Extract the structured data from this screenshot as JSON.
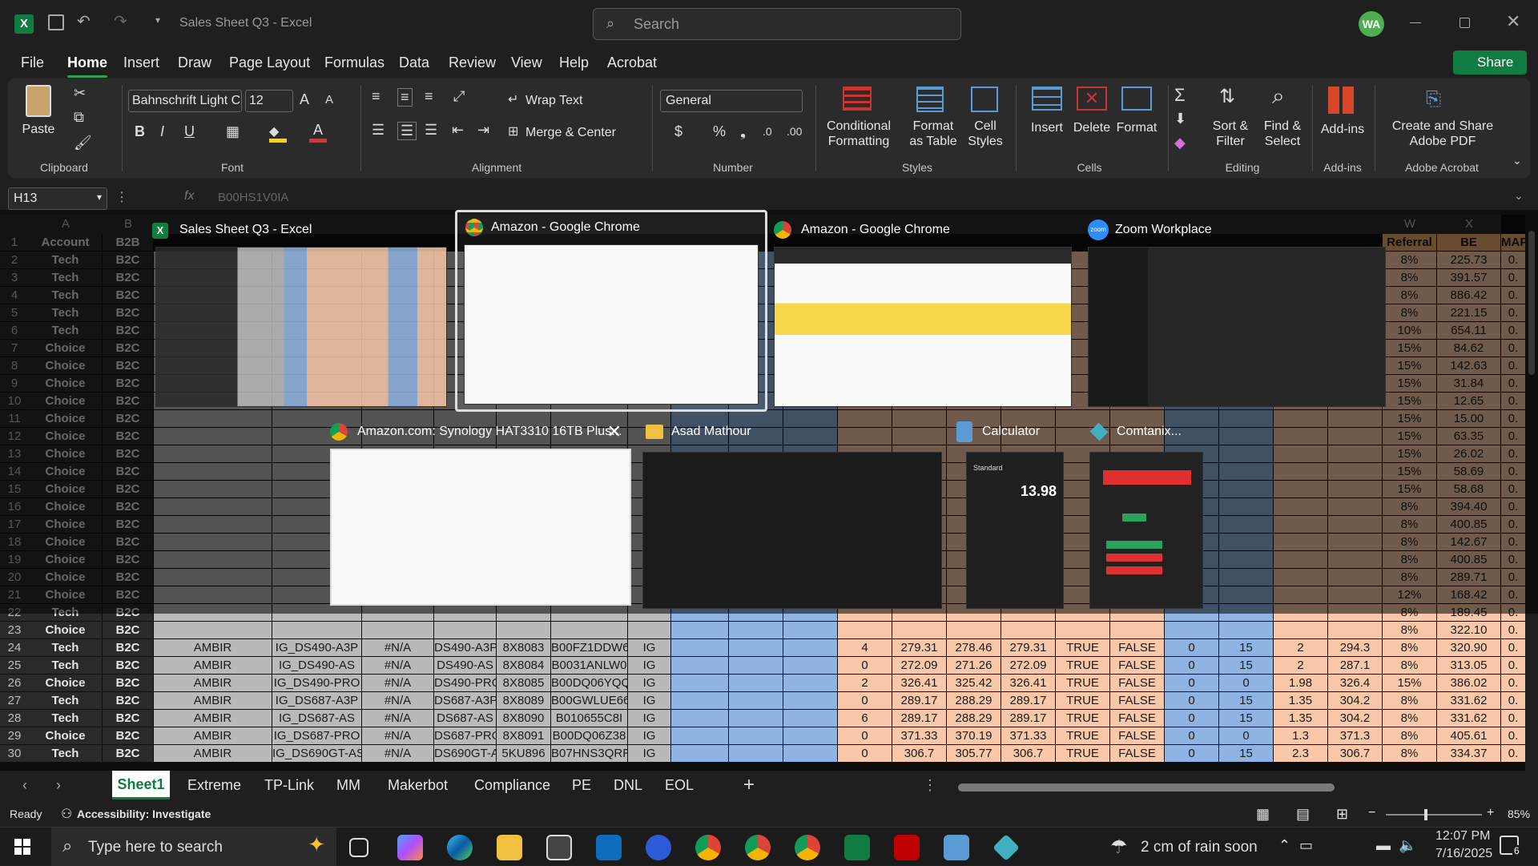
{
  "window": {
    "title": "Sales Sheet Q3 - Excel",
    "search_placeholder": "Search",
    "user_initials": "WA",
    "share_label": "Share"
  },
  "menu": [
    "File",
    "Home",
    "Insert",
    "Draw",
    "Page Layout",
    "Formulas",
    "Data",
    "Review",
    "View",
    "Help",
    "Acrobat"
  ],
  "ribbon": {
    "clipboard": {
      "paste": "Paste",
      "group": "Clipboard"
    },
    "font": {
      "name": "Bahnschrift Light C",
      "size": "12",
      "group": "Font"
    },
    "alignment": {
      "wrap": "Wrap Text",
      "merge": "Merge & Center",
      "group": "Alignment"
    },
    "number": {
      "format": "General",
      "group": "Number"
    },
    "styles": {
      "conditional": "Conditional Formatting",
      "format_table": "Format as Table",
      "cell_styles": "Cell Styles",
      "group": "Styles"
    },
    "cells": {
      "insert": "Insert",
      "delete": "Delete",
      "format": "Format",
      "group": "Cells"
    },
    "editing": {
      "sort": "Sort & Filter",
      "find": "Find & Select",
      "group": "Editing"
    },
    "addins": {
      "label": "Add-ins",
      "group": "Add-ins"
    },
    "acrobat": {
      "label": "Create and Share Adobe PDF",
      "group": "Adobe Acrobat"
    }
  },
  "formula": {
    "name_box": "H13",
    "fx": "fx",
    "content": "B00HS1V0IA"
  },
  "columns": [
    "A",
    "B",
    "",
    "",
    "",
    "",
    "",
    "",
    "",
    "",
    "",
    "",
    "",
    "",
    "",
    "",
    "",
    "",
    "",
    "",
    "",
    "",
    "",
    "",
    "W",
    "X"
  ],
  "rows": [
    {
      "n": "1",
      "a": "Account",
      "b": "B2B"
    },
    {
      "n": "2",
      "a": "Tech",
      "b": "B2C"
    },
    {
      "n": "3",
      "a": "Tech",
      "b": "B2C"
    },
    {
      "n": "4",
      "a": "Tech",
      "b": "B2C"
    },
    {
      "n": "5",
      "a": "Tech",
      "b": "B2C"
    },
    {
      "n": "6",
      "a": "Tech",
      "b": "B2C"
    },
    {
      "n": "7",
      "a": "Choice",
      "b": "B2C"
    },
    {
      "n": "8",
      "a": "Choice",
      "b": "B2C"
    },
    {
      "n": "9",
      "a": "Choice",
      "b": "B2C"
    },
    {
      "n": "10",
      "a": "Choice",
      "b": "B2C"
    },
    {
      "n": "11",
      "a": "Choice",
      "b": "B2C"
    },
    {
      "n": "12",
      "a": "Choice",
      "b": "B2C"
    },
    {
      "n": "13",
      "a": "Choice",
      "b": "B2C"
    },
    {
      "n": "14",
      "a": "Choice",
      "b": "B2C"
    },
    {
      "n": "15",
      "a": "Choice",
      "b": "B2C"
    },
    {
      "n": "16",
      "a": "Choice",
      "b": "B2C"
    },
    {
      "n": "17",
      "a": "Choice",
      "b": "B2C"
    },
    {
      "n": "18",
      "a": "Choice",
      "b": "B2C"
    },
    {
      "n": "19",
      "a": "Choice",
      "b": "B2C"
    },
    {
      "n": "20",
      "a": "Choice",
      "b": "B2C"
    },
    {
      "n": "21",
      "a": "Choice",
      "b": "B2C"
    },
    {
      "n": "22",
      "a": "Tech",
      "b": "B2C"
    },
    {
      "n": "23",
      "a": "Choice",
      "b": "B2C"
    },
    {
      "n": "24",
      "a": "Tech",
      "b": "B2C"
    },
    {
      "n": "25",
      "a": "Tech",
      "b": "B2C"
    },
    {
      "n": "26",
      "a": "Choice",
      "b": "B2C"
    },
    {
      "n": "27",
      "a": "Tech",
      "b": "B2C"
    },
    {
      "n": "28",
      "a": "Tech",
      "b": "B2C"
    },
    {
      "n": "29",
      "a": "Choice",
      "b": "B2C"
    },
    {
      "n": "30",
      "a": "Tech",
      "b": "B2C"
    }
  ],
  "right_col": {
    "header_w": "Referral",
    "header_x": "BE",
    "header_y": "MAP",
    "be": [
      "225.73",
      "391.57",
      "886.42",
      "221.15",
      "654.11",
      "84.62",
      "142.63",
      "31.84",
      "12.65",
      "15.00",
      "63.35",
      "26.02",
      "58.69",
      "58.68",
      "394.40",
      "400.85",
      "142.67",
      "400.85",
      "289.71",
      "168.42",
      "189.45",
      "322.10",
      "320.90",
      "313.05",
      "386.02",
      "331.62",
      "331.62",
      "405.61",
      "334.37"
    ],
    "ref": [
      "8%",
      "8%",
      "8%",
      "8%",
      "10%",
      "15%",
      "15%",
      "15%",
      "15%",
      "15%",
      "15%",
      "15%",
      "15%",
      "15%",
      "8%",
      "8%",
      "8%",
      "8%",
      "8%",
      "12%",
      "8%",
      "8%",
      "8%",
      "8%",
      "15%",
      "8%",
      "8%",
      "8%",
      "8%"
    ]
  },
  "visible_rows": [
    {
      "c": "AMBIR",
      "d": "IG_DS490-A3P",
      "e": "#N/A",
      "f": "DS490-A3P",
      "g": "8X8083",
      "h": "B00FZ1DDW6",
      "i": "IG",
      "n": "4",
      "o": "279.31",
      "p": "278.46",
      "q": "279.31",
      "r": "TRUE",
      "s": "FALSE",
      "t": "0",
      "u": "15",
      "v": "2",
      "w": "294.3"
    },
    {
      "c": "AMBIR",
      "d": "IG_DS490-AS",
      "e": "#N/A",
      "f": "DS490-AS",
      "g": "8X8084",
      "h": "B0031ANLW0",
      "i": "IG",
      "n": "0",
      "o": "272.09",
      "p": "271.26",
      "q": "272.09",
      "r": "TRUE",
      "s": "FALSE",
      "t": "0",
      "u": "15",
      "v": "2",
      "w": "287.1"
    },
    {
      "c": "AMBIR",
      "d": "IG_DS490-PRO",
      "e": "#N/A",
      "f": "DS490-PRO",
      "g": "8X8085",
      "h": "B00DQ06YQQ",
      "i": "IG",
      "n": "2",
      "o": "326.41",
      "p": "325.42",
      "q": "326.41",
      "r": "TRUE",
      "s": "FALSE",
      "t": "0",
      "u": "0",
      "v": "1.98",
      "w": "326.4"
    },
    {
      "c": "AMBIR",
      "d": "IG_DS687-A3P",
      "e": "#N/A",
      "f": "DS687-A3P",
      "g": "8X8089",
      "h": "B00GWLUE66",
      "i": "IG",
      "n": "0",
      "o": "289.17",
      "p": "288.29",
      "q": "289.17",
      "r": "TRUE",
      "s": "FALSE",
      "t": "0",
      "u": "15",
      "v": "1.35",
      "w": "304.2"
    },
    {
      "c": "AMBIR",
      "d": "IG_DS687-AS",
      "e": "#N/A",
      "f": "DS687-AS",
      "g": "8X8090",
      "h": "B010655C8I",
      "i": "IG",
      "n": "6",
      "o": "289.17",
      "p": "288.29",
      "q": "289.17",
      "r": "TRUE",
      "s": "FALSE",
      "t": "0",
      "u": "15",
      "v": "1.35",
      "w": "304.2"
    },
    {
      "c": "AMBIR",
      "d": "IG_DS687-PRO",
      "e": "#N/A",
      "f": "DS687-PRO",
      "g": "8X8091",
      "h": "B00DQ06Z38",
      "i": "IG",
      "n": "0",
      "o": "371.33",
      "p": "370.19",
      "q": "371.33",
      "r": "TRUE",
      "s": "FALSE",
      "t": "0",
      "u": "0",
      "v": "1.3",
      "w": "371.3"
    },
    {
      "c": "AMBIR",
      "d": "IG_DS690GT-AS",
      "e": "#N/A",
      "f": "DS690GT-AS",
      "g": "5KU896",
      "h": "B07HNS3QRR",
      "i": "IG",
      "n": "0",
      "o": "306.7",
      "p": "305.77",
      "q": "306.7",
      "r": "TRUE",
      "s": "FALSE",
      "t": "0",
      "u": "15",
      "v": "2.3",
      "w": "306.7"
    }
  ],
  "task_switcher": [
    {
      "title": "Sales Sheet Q3 - Excel",
      "app": "excel"
    },
    {
      "title": "Amazon - Google Chrome",
      "app": "chrome"
    },
    {
      "title": "Amazon - Google Chrome",
      "app": "chrome"
    },
    {
      "title": "Zoom Workplace",
      "app": "zoom"
    },
    {
      "title": "Amazon.com: Synology HAT3310 16TB Plus...",
      "app": "chrome"
    },
    {
      "title": "Asad Mathour",
      "app": "folder"
    },
    {
      "title": "Calculator",
      "app": "calc"
    },
    {
      "title": "Comtanix...",
      "app": "comtanix"
    }
  ],
  "calculator": {
    "mode": "Standard",
    "value": "13.98"
  },
  "sheet_tabs": [
    "Sheet1",
    "Extreme",
    "TP-Link",
    "MM",
    "Makerbot",
    "Compliance",
    "PE",
    "DNL",
    "EOL"
  ],
  "status": {
    "ready": "Ready",
    "accessibility": "Accessibility: Investigate",
    "zoom": "85%"
  },
  "taskbar": {
    "search": "Type here to search",
    "weather": "2 cm of rain soon",
    "time": "12:07 PM",
    "date": "7/16/2025",
    "notif": "6"
  },
  "colors": {
    "accent": "#107c41",
    "orange": "#f8c8a8",
    "blue": "#8fb4e3",
    "green_cell": "#fde0cc"
  }
}
